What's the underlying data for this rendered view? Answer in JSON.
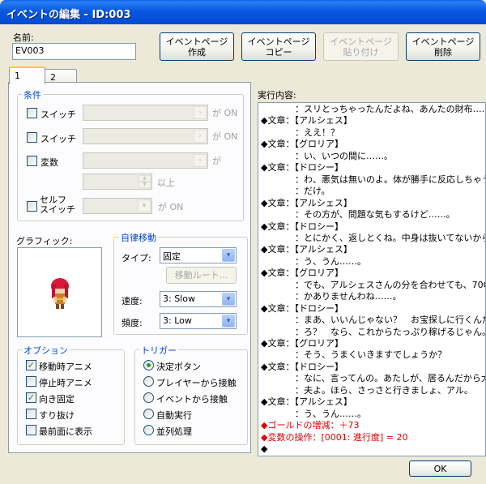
{
  "window": {
    "title": "イベントの編集 - ID:003"
  },
  "name": {
    "label": "名前:",
    "value": "EV003"
  },
  "toolbar": {
    "create": "イベントページ\n作成",
    "copy": "イベントページ\nコピー",
    "paste": "イベントページ\n貼り付け",
    "delete": "イベントページ\n削除"
  },
  "tabs": [
    "1",
    "2"
  ],
  "conditions": {
    "title": "条件",
    "switch1": "スイッチ",
    "switch2": "スイッチ",
    "variable": "変数",
    "self_switch": "セルフ\nスイッチ",
    "is_on": "が ON",
    "ga": "が",
    "ijou": "以上"
  },
  "graphic": {
    "label": "グラフィック:"
  },
  "autonomous": {
    "title": "自律移動",
    "type_label": "タイプ:",
    "type_value": "固定",
    "route_button": "移動ルート...",
    "speed_label": "速度:",
    "speed_value": "3: Slow",
    "freq_label": "頻度:",
    "freq_value": "3: Low"
  },
  "options": {
    "title": "オプション",
    "items": [
      {
        "label": "移動時アニメ",
        "checked": true
      },
      {
        "label": "停止時アニメ",
        "checked": false
      },
      {
        "label": "向き固定",
        "checked": true
      },
      {
        "label": "すり抜け",
        "checked": false
      },
      {
        "label": "最前面に表示",
        "checked": false
      }
    ]
  },
  "trigger": {
    "title": "トリガー",
    "items": [
      {
        "label": "決定ボタン",
        "selected": true
      },
      {
        "label": "プレイヤーから接触",
        "selected": false
      },
      {
        "label": "イベントから接触",
        "selected": false
      },
      {
        "label": "自動実行",
        "selected": false
      },
      {
        "label": "並列処理",
        "selected": false
      }
    ]
  },
  "contents": {
    "label": "実行内容:",
    "lines": [
      {
        "prefix": "",
        "text": "：スリとっちゃったんだよね、あんたの財布……。",
        "color": "black"
      },
      {
        "prefix": "◆",
        "text": "文章：【アルシェス】",
        "color": "black"
      },
      {
        "prefix": "",
        "text": "：ええ！？",
        "color": "black"
      },
      {
        "prefix": "◆",
        "text": "文章：【グロリア】",
        "color": "black"
      },
      {
        "prefix": "",
        "text": "：い、いつの間に……。",
        "color": "black"
      },
      {
        "prefix": "◆",
        "text": "文章：【ドロシー】",
        "color": "black"
      },
      {
        "prefix": "",
        "text": "：わ、悪気は無いのよ。体が勝手に反応しちゃう",
        "color": "black"
      },
      {
        "prefix": "",
        "text": "：だけ。",
        "color": "black"
      },
      {
        "prefix": "◆",
        "text": "文章：【アルシェス】",
        "color": "black"
      },
      {
        "prefix": "",
        "text": "：その方が、問題な気もするけど……。",
        "color": "black"
      },
      {
        "prefix": "◆",
        "text": "文章：【ドロシー】",
        "color": "black"
      },
      {
        "prefix": "",
        "text": "：とにかく、返しとくね。中身は抜いてないから。",
        "color": "black"
      },
      {
        "prefix": "◆",
        "text": "文章：【アルシェス】",
        "color": "black"
      },
      {
        "prefix": "",
        "text": "：う、うん……。",
        "color": "black"
      },
      {
        "prefix": "◆",
        "text": "文章：【グロリア】",
        "color": "black"
      },
      {
        "prefix": "",
        "text": "：でも、アルシェスさんの分を合わせても、70Gし",
        "color": "black"
      },
      {
        "prefix": "",
        "text": "：かありませんわね……。",
        "color": "black"
      },
      {
        "prefix": "◆",
        "text": "文章：【ドロシー】",
        "color": "black"
      },
      {
        "prefix": "",
        "text": "：まあ、いいんじゃない？　お宝探しに行くんだ",
        "color": "black"
      },
      {
        "prefix": "",
        "text": "：ろ？　なら、これからたっぷり稼げるじゃん。",
        "color": "black"
      },
      {
        "prefix": "◆",
        "text": "文章：【グロリア】",
        "color": "black"
      },
      {
        "prefix": "",
        "text": "：そう、うまくいきますでしょうか？",
        "color": "black"
      },
      {
        "prefix": "◆",
        "text": "文章：【ドロシー】",
        "color": "black"
      },
      {
        "prefix": "",
        "text": "：なに、言ってんの。あたしが、居るんだから大丈",
        "color": "black"
      },
      {
        "prefix": "",
        "text": "：夫よ。ほら、さっさと行きましょ、アル。",
        "color": "black"
      },
      {
        "prefix": "◆",
        "text": "文章：【アルシェス】",
        "color": "black"
      },
      {
        "prefix": "",
        "text": "：う、うん……。",
        "color": "black"
      },
      {
        "prefix": "◆",
        "text": "ゴールドの増減：＋73",
        "color": "red"
      },
      {
        "prefix": "◆",
        "text": "変数の操作：[0001: 進行度] = 20",
        "color": "red"
      },
      {
        "prefix": "◆",
        "text": "",
        "color": "black"
      }
    ]
  },
  "footer": {
    "ok": "OK"
  }
}
